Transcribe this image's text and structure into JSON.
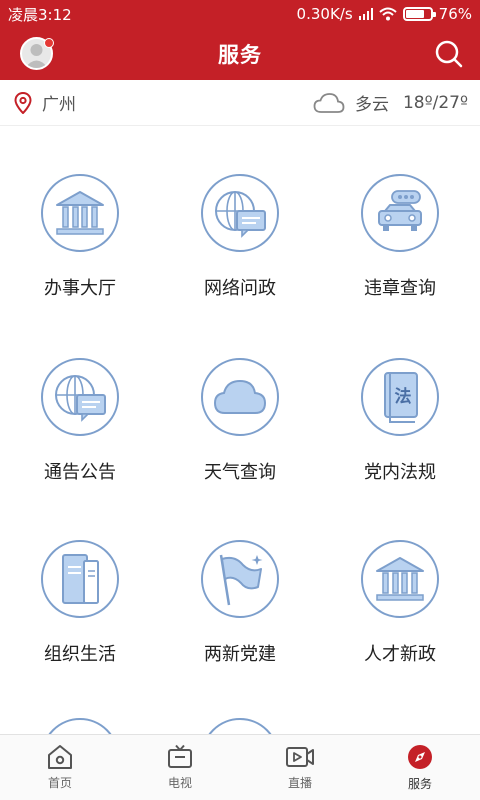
{
  "status": {
    "time": "凌晨3:12",
    "speed": "0.30K/s",
    "battery": "76%",
    "battery_level": 0.76
  },
  "header": {
    "title": "服务"
  },
  "location": {
    "city": "广州",
    "weather": "多云",
    "temperature": "18º/27º"
  },
  "services": [
    {
      "label": "办事大厅",
      "icon": "bank-building-icon"
    },
    {
      "label": "网络问政",
      "icon": "globe-chat-icon"
    },
    {
      "label": "违章查询",
      "icon": "car-icon"
    },
    {
      "label": "通告公告",
      "icon": "globe-notice-icon"
    },
    {
      "label": "天气查询",
      "icon": "cloud-icon"
    },
    {
      "label": "党内法规",
      "icon": "law-book-icon"
    },
    {
      "label": "组织生活",
      "icon": "document-icon"
    },
    {
      "label": "两新党建",
      "icon": "flag-icon"
    },
    {
      "label": "人才新政",
      "icon": "bank-building-icon"
    }
  ],
  "tabs": [
    {
      "label": "首页",
      "icon": "home-icon",
      "active": false
    },
    {
      "label": "电视",
      "icon": "tv-icon",
      "active": false
    },
    {
      "label": "直播",
      "icon": "live-video-icon",
      "active": false
    },
    {
      "label": "服务",
      "icon": "compass-icon",
      "active": true
    }
  ],
  "colors": {
    "brand": "#c42027",
    "icon_blue": "#7d9fcc",
    "icon_fill": "#b9d2f0"
  }
}
